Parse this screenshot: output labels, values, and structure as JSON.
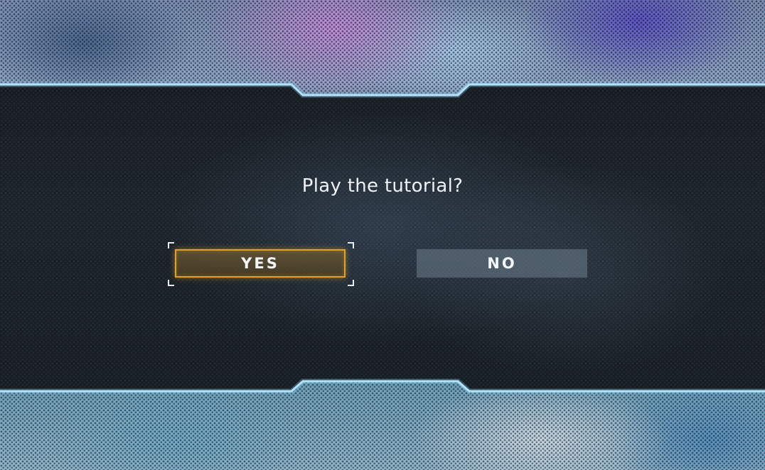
{
  "dialog": {
    "prompt": "Play the tutorial?",
    "yes_label": "YES",
    "no_label": "NO",
    "selected": "YES"
  },
  "colors": {
    "frame_line": "#cfe9f5",
    "selected_border": "#e0a12a",
    "unselected_button": "#6e7d8c"
  }
}
